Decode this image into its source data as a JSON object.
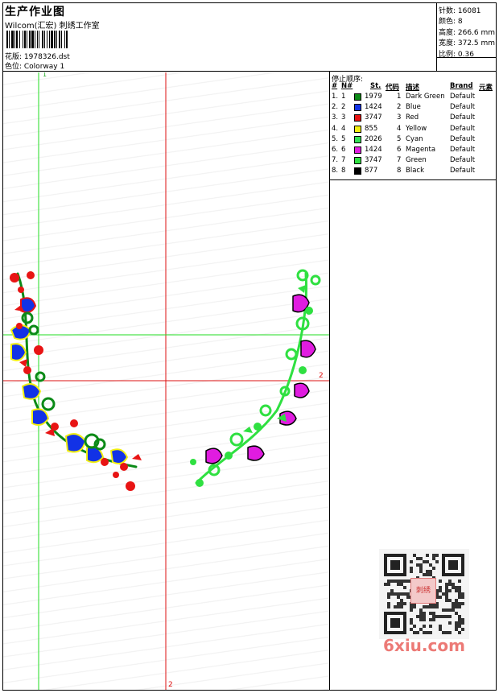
{
  "header": {
    "title": "生产作业图",
    "subtitle": "Wilcom(汇宏) 刺绣工作室",
    "design_label": "花版: 1978326.dst",
    "colorway_label": "色位: Colorway 1"
  },
  "stats": {
    "stitches": "针数: 16081",
    "colors": "颜色: 8",
    "height": "高度: 266.6 mm",
    "width": "宽度: 372.5 mm",
    "scale": "比例: 0.36"
  },
  "guides": {
    "vertical_green_label": "1",
    "vertical_red_label": "2",
    "horizontal_red_label": "2"
  },
  "legend": {
    "title": "停止顺序:",
    "headers": {
      "hash": "#",
      "num": "N#",
      "st": "St.",
      "code": "代码",
      "desc": "描述",
      "brand": "Brand",
      "element": "元素"
    },
    "rows": [
      {
        "idx": "1.",
        "n": "1",
        "color": "#0b8a17",
        "st": "1979",
        "code": "1",
        "desc": "Dark Green",
        "brand": "Default"
      },
      {
        "idx": "2.",
        "n": "2",
        "color": "#1232e6",
        "st": "1424",
        "code": "2",
        "desc": "Blue",
        "brand": "Default"
      },
      {
        "idx": "3.",
        "n": "3",
        "color": "#e81414",
        "st": "3747",
        "code": "3",
        "desc": "Red",
        "brand": "Default"
      },
      {
        "idx": "4.",
        "n": "4",
        "color": "#f2ef10",
        "st": "855",
        "code": "4",
        "desc": "Yellow",
        "brand": "Default"
      },
      {
        "idx": "5.",
        "n": "5",
        "color": "#33e055",
        "st": "2026",
        "code": "5",
        "desc": "Cyan",
        "brand": "Default"
      },
      {
        "idx": "6.",
        "n": "6",
        "color": "#e01ce0",
        "st": "1424",
        "code": "6",
        "desc": "Magenta",
        "brand": "Default"
      },
      {
        "idx": "7.",
        "n": "7",
        "color": "#2fe041",
        "st": "3747",
        "code": "7",
        "desc": "Green",
        "brand": "Default"
      },
      {
        "idx": "8.",
        "n": "8",
        "color": "#000000",
        "st": "877",
        "code": "8",
        "desc": "Black",
        "brand": "Default"
      }
    ]
  },
  "watermark": {
    "text": "6xiu.com",
    "qr_center": "刺绣"
  }
}
